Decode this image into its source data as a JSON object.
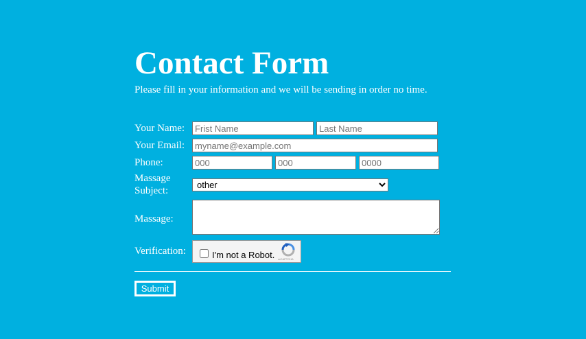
{
  "header": {
    "title": "Contact Form",
    "subtitle": "Please fill in your information and we will be sending in order no time."
  },
  "form": {
    "name_label": "Your Name:",
    "first_name_placeholder": "Frist Name",
    "last_name_placeholder": "Last Name",
    "email_label": "Your Email:",
    "email_placeholder": "myname@example.com",
    "phone_label": "Phone:",
    "phone_area_placeholder": "000",
    "phone_prefix_placeholder": "000",
    "phone_line_placeholder": "0000",
    "subject_label": "Massage Subject:",
    "subject_selected": "other",
    "message_label": "Massage:",
    "message_value": "",
    "verification_label": "Verification:",
    "captcha_label": "I'm not a Robot.",
    "captcha_brand": "reCAPTCHA",
    "submit_label": "Submit"
  },
  "colors": {
    "background": "#00b0e0",
    "text": "#ffffff",
    "captcha_blue": "#4a90e2",
    "captcha_grey": "#b0b0b0"
  },
  "icons": {
    "captcha_logo": "recaptcha-logo-icon"
  }
}
